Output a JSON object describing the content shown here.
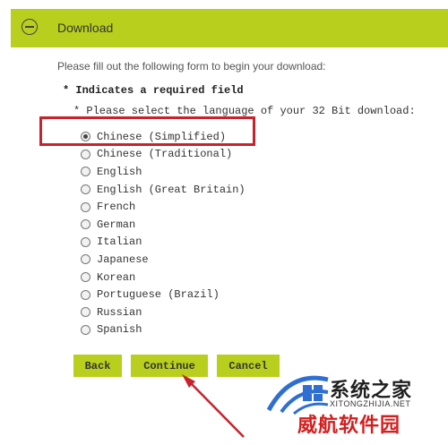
{
  "header": {
    "title": "Download",
    "toggle_icon": "collapse-minus-icon",
    "background_color": "#b9cf1d"
  },
  "form": {
    "intro": "Please fill out the following form to begin your download:",
    "required_note": "* Indicates a required field",
    "language_prompt": "* Please select the language of your 32 Bit download:",
    "selected": "Chinese (Simplified)",
    "languages": [
      "Chinese (Simplified)",
      "Chinese (Traditional)",
      "English",
      "English (Great Britain)",
      "French",
      "German",
      "Italian",
      "Japanese",
      "Korean",
      "Portuguese (Brazil)",
      "Russian",
      "Spanish"
    ]
  },
  "buttons": {
    "back": "Back",
    "continue": "Continue",
    "cancel": "Cancel",
    "color": "#b9cf1d"
  },
  "annotations": {
    "highlight_color": "#c8232c",
    "arrow_color": "#c8232c"
  },
  "watermark": {
    "title": "系统之家",
    "url": "XITONGZHIJIA.NET",
    "subtitle": "威航软件园"
  }
}
